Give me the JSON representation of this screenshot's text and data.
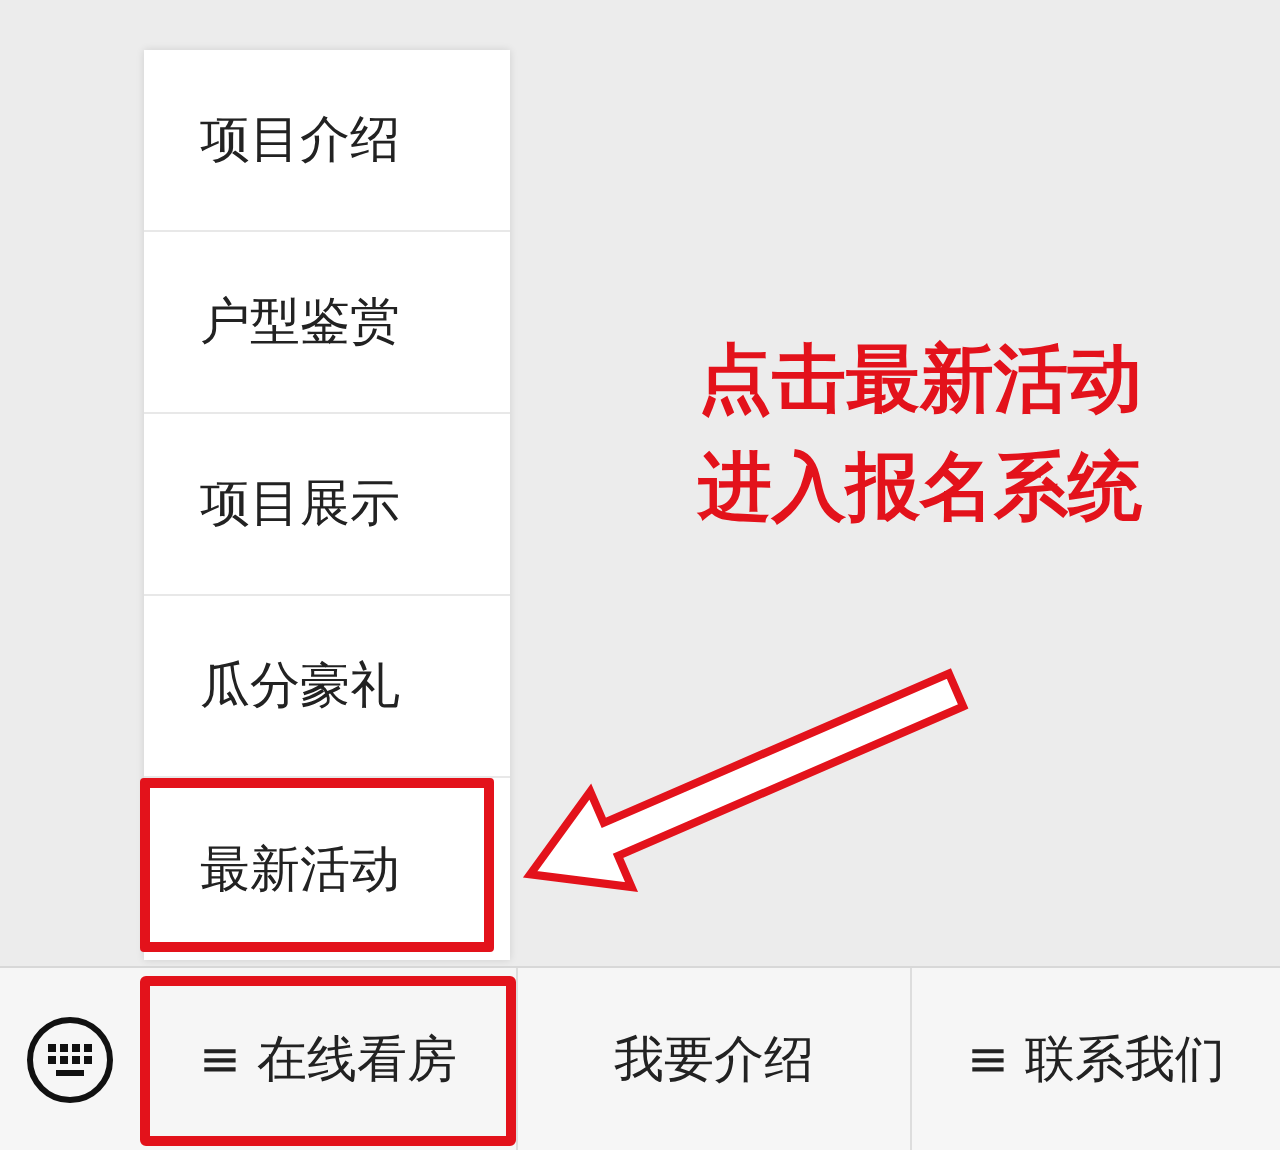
{
  "menu": {
    "items": [
      {
        "label": "项目介绍",
        "highlighted": false
      },
      {
        "label": "户型鉴赏",
        "highlighted": false
      },
      {
        "label": "项目展示",
        "highlighted": false
      },
      {
        "label": "瓜分豪礼",
        "highlighted": false
      },
      {
        "label": "最新活动",
        "highlighted": true
      }
    ]
  },
  "annotation": {
    "lines": [
      "点击最新活动",
      "进入报名系统"
    ]
  },
  "bottom_bar": {
    "tabs": [
      {
        "label": "≡ 在线看房",
        "highlighted": true
      },
      {
        "label": "我要介绍",
        "highlighted": false
      },
      {
        "label": "≡ 联系我们",
        "highlighted": false
      }
    ]
  }
}
